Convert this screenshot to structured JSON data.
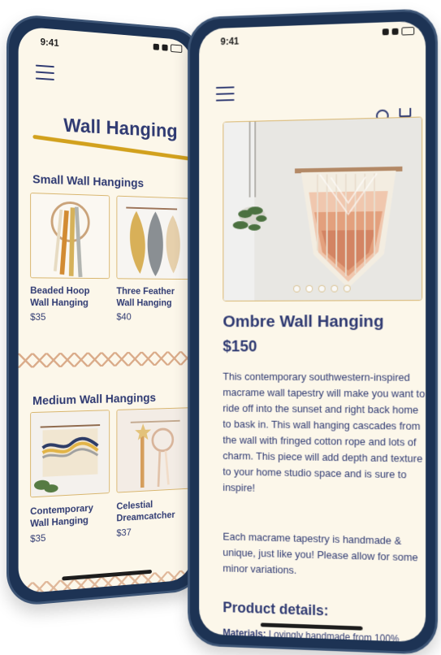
{
  "status_bar": {
    "time_back": "9:41",
    "time_front": "9:41"
  },
  "back_screen": {
    "page_title": "Wall Hanging",
    "sections": {
      "small_title": "Small Wall Hangings",
      "medium_title": "Medium Wall Hangings"
    },
    "products": [
      {
        "name": "Beaded Hoop Wall Hanging",
        "price": "$35"
      },
      {
        "name": "Three Feather Wall Hanging",
        "price": "$40"
      },
      {
        "name": "Contemporary Wall Hanging",
        "price": "$35"
      },
      {
        "name": "Celestial Dreamcatcher",
        "price": "$37"
      }
    ]
  },
  "front_screen": {
    "title": "Ombre Wall Hanging",
    "price": "$150",
    "description_1": "This contemporary southwestern-inspired macrame wall tapestry will make you want to ride off into the sunset and right back home to bask in. This wall hanging cascades from the wall with fringed cotton rope and lots of charm. This piece will add depth and texture to your home studio space and is sure to inspire!",
    "description_2": "Each macrame tapestry is handmade & unique, just like you! Please allow for some minor variations.",
    "details_title": "Product details:",
    "materials_label": "Materials:",
    "materials_text": "Lovingly handmade from 100%"
  },
  "icons": {
    "menu": "menu-icon",
    "search": "search-icon",
    "cart": "cart-icon"
  },
  "colors": {
    "brand_navy": "#2f3a72",
    "accent_gold": "#d2a11d",
    "screen_bg": "#fcf7ea",
    "phone_frame": "#1d3354"
  },
  "carousel": {
    "active_index": 1,
    "count": 5
  }
}
